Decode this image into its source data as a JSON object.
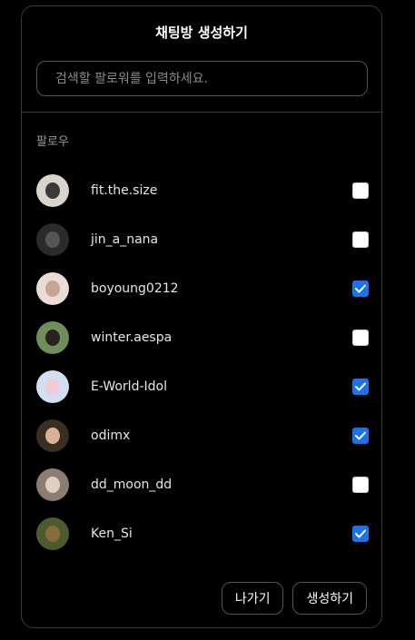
{
  "modal": {
    "title": "채팅방 생성하기",
    "search_placeholder": "검색할 팔로워를 입력하세요.",
    "section_label": "팔로우",
    "followers": [
      {
        "username": "fit.the.size",
        "checked": false,
        "avatar": {
          "bg": "#d9d4cc",
          "face": "#3a3a3a"
        }
      },
      {
        "username": "jin_a_nana",
        "checked": false,
        "avatar": {
          "bg": "#2b2b2b",
          "face": "#555555"
        }
      },
      {
        "username": "boyoung0212",
        "checked": true,
        "avatar": {
          "bg": "#e9dcd6",
          "face": "#c9a58f"
        }
      },
      {
        "username": "winter.aespa",
        "checked": false,
        "avatar": {
          "bg": "#6f8f5a",
          "face": "#2a2222"
        }
      },
      {
        "username": "E-World-Idol",
        "checked": true,
        "avatar": {
          "bg": "#cfe0f2",
          "face": "#f3c9d6"
        }
      },
      {
        "username": "odimx",
        "checked": true,
        "avatar": {
          "bg": "#3a2e22",
          "face": "#d8b39a"
        }
      },
      {
        "username": "dd_moon_dd",
        "checked": false,
        "avatar": {
          "bg": "#8a7d74",
          "face": "#e2cfc2"
        }
      },
      {
        "username": "Ken_Si",
        "checked": true,
        "avatar": {
          "bg": "#4c5a2e",
          "face": "#8b6b3c"
        }
      }
    ],
    "buttons": {
      "exit": "나가기",
      "create": "생성하기"
    }
  },
  "colors": {
    "checkbox_checked": "#1a73e8",
    "checkbox_unchecked": "#ffffff",
    "background": "#000000",
    "border": "#3a3a3a"
  }
}
